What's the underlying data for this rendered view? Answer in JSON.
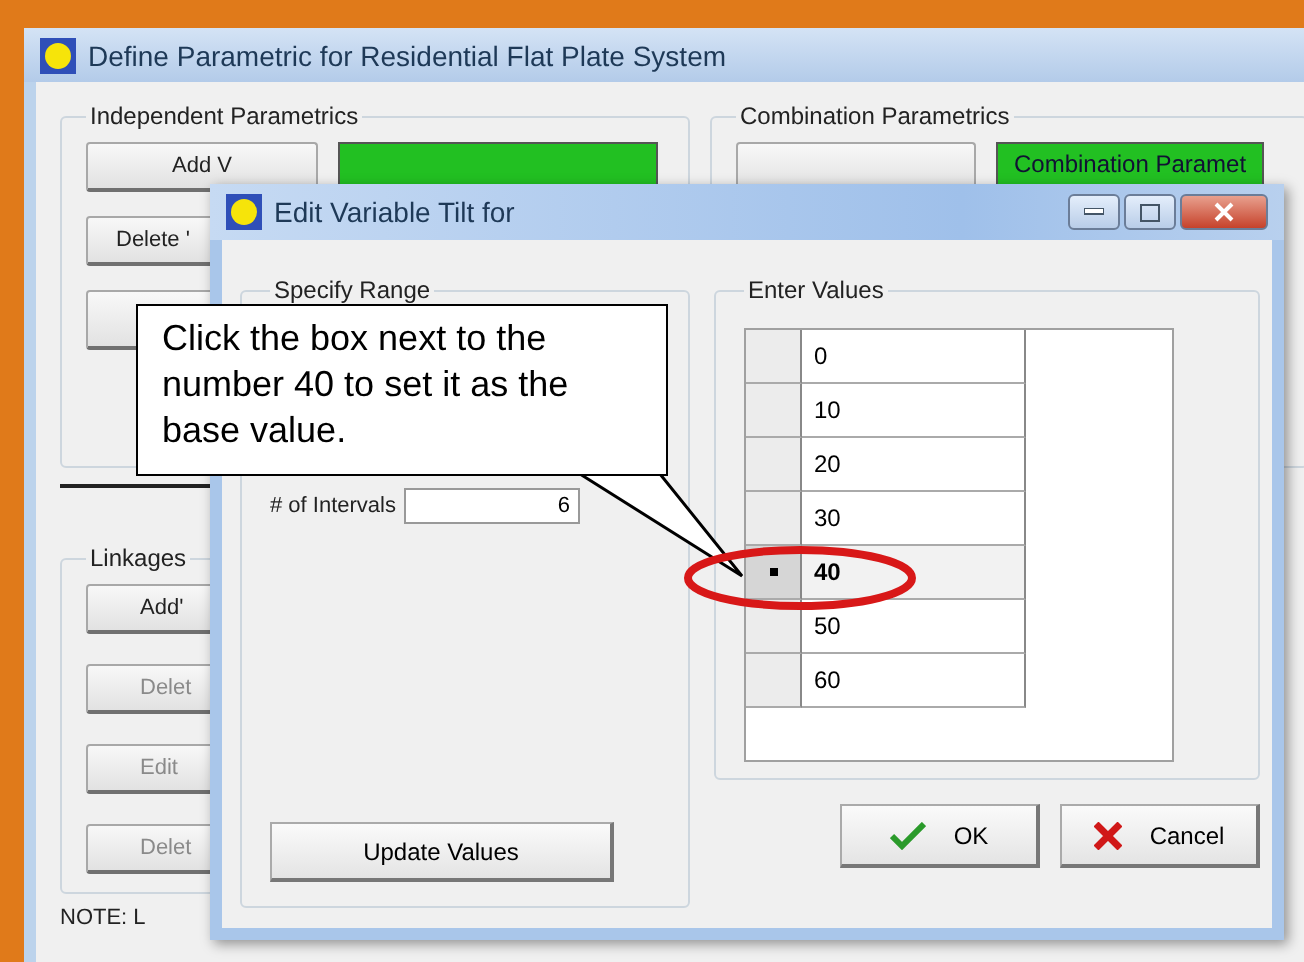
{
  "main_window": {
    "title": "Define Parametric for Residential Flat Plate System",
    "independent_parametrics": {
      "label": "Independent Parametrics",
      "buttons": [
        {
          "label": "Add V",
          "disabled": false
        },
        {
          "label": "Delete '",
          "disabled": false
        }
      ]
    },
    "combination_parametrics": {
      "label": "Combination Parametrics",
      "list_header": "Combination Paramet"
    },
    "linkages": {
      "label": "Linkages",
      "buttons": [
        {
          "label": "Add'",
          "disabled": false
        },
        {
          "label": "Delet",
          "disabled": true
        },
        {
          "label": "Edit",
          "disabled": true
        },
        {
          "label": "Delet",
          "disabled": true
        }
      ]
    },
    "note": "NOTE: L"
  },
  "dialog": {
    "title": "Edit Variable Tilt for",
    "specify_range": {
      "label": "Specify Range",
      "intervals_label": "# of Intervals",
      "intervals_value": "6",
      "update_button": "Update Values"
    },
    "enter_values": {
      "label": "Enter Values",
      "rows": [
        {
          "value": "0",
          "selected": false
        },
        {
          "value": "10",
          "selected": false
        },
        {
          "value": "20",
          "selected": false
        },
        {
          "value": "30",
          "selected": false
        },
        {
          "value": "40",
          "selected": true
        },
        {
          "value": "50",
          "selected": false
        },
        {
          "value": "60",
          "selected": false
        }
      ]
    },
    "buttons": [
      {
        "kind": "ok",
        "label": "OK"
      },
      {
        "kind": "cancel",
        "label": "Cancel"
      }
    ]
  },
  "callout": {
    "text": "Click the box next to the number 40 to set it as the base value."
  }
}
